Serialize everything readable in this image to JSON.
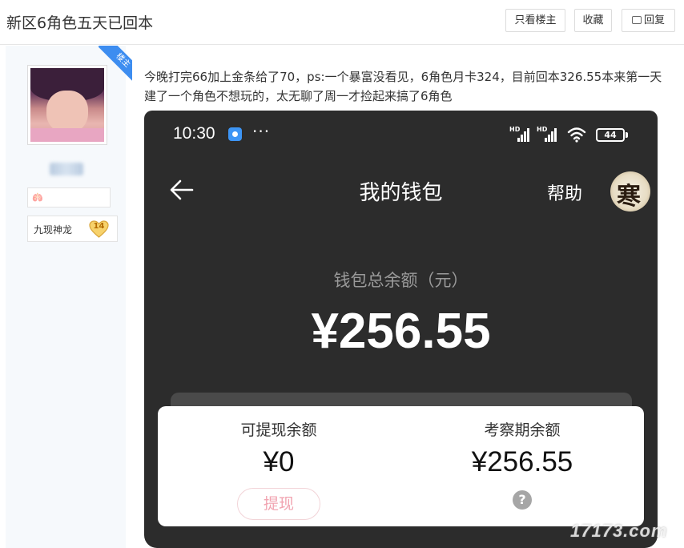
{
  "header": {
    "title": "新区6角色五天已回本",
    "buttons": {
      "only_owner": "只看楼主",
      "favorite": "收藏",
      "reply": "回复"
    }
  },
  "author": {
    "ribbon": "楼主",
    "avatar_icon": "user-avatar",
    "rank_badge": "九现神龙",
    "level": "14"
  },
  "post": {
    "text": "今晚打完66加上金条给了70，ps:一个暴富没看见，6角色月卡324，目前回本326.55本来第一天建了一个角色不想玩的，太无聊了周一才捡起来搞了6角色"
  },
  "phone": {
    "status": {
      "time": "10:30",
      "dots": "···",
      "signal_label": "HD",
      "battery": "44"
    },
    "nav": {
      "title": "我的钱包",
      "help": "帮助",
      "avatar_char": "寒"
    },
    "wallet": {
      "total_label": "钱包总余额（元）",
      "total_amount": "¥256.55",
      "withdrawable_label": "可提现余额",
      "withdrawable_amount": "¥0",
      "withdraw_button": "提现",
      "review_label": "考察期余额",
      "review_amount": "¥256.55",
      "review_help": "?"
    }
  },
  "watermark": "17173.com",
  "colors": {
    "ribbon": "#3d8df0",
    "phone_bg": "#2c2c2c",
    "withdraw_text": "#f1a3b0"
  }
}
